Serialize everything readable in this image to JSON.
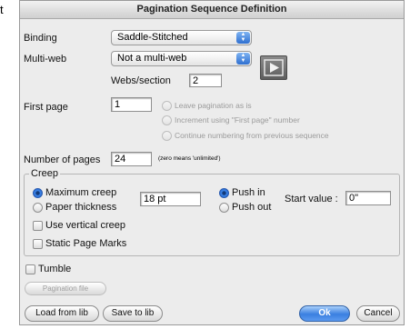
{
  "stray_letter": "t",
  "window": {
    "title": "Pagination Sequence Definition"
  },
  "binding": {
    "label": "Binding",
    "value": "Saddle-Stitched"
  },
  "multiweb": {
    "label": "Multi-web",
    "value": "Not a multi-web",
    "webs_label": "Webs/section",
    "webs_value": "2"
  },
  "first_page": {
    "label": "First page",
    "value": "1",
    "options": [
      "Leave pagination as is",
      "Increment using \"First page\" number",
      "Continue numbering from previous sequence"
    ]
  },
  "num_pages": {
    "label": "Number of pages",
    "value": "24",
    "hint": "(zero means 'unlimited')"
  },
  "creep": {
    "legend": "Creep",
    "max_creep": "Maximum creep",
    "paper_thickness": "Paper thickness",
    "value": "18 pt",
    "push_in": "Push in",
    "push_out": "Push out",
    "start_label": "Start value :",
    "start_value": "0\"",
    "vertical_creep": "Use vertical creep",
    "static_marks": "Static Page Marks"
  },
  "tumble": {
    "label": "Tumble"
  },
  "buttons": {
    "pagination_file": "Pagination file",
    "load": "Load from lib",
    "save": "Save to lib",
    "ok": "Ok",
    "cancel": "Cancel"
  }
}
